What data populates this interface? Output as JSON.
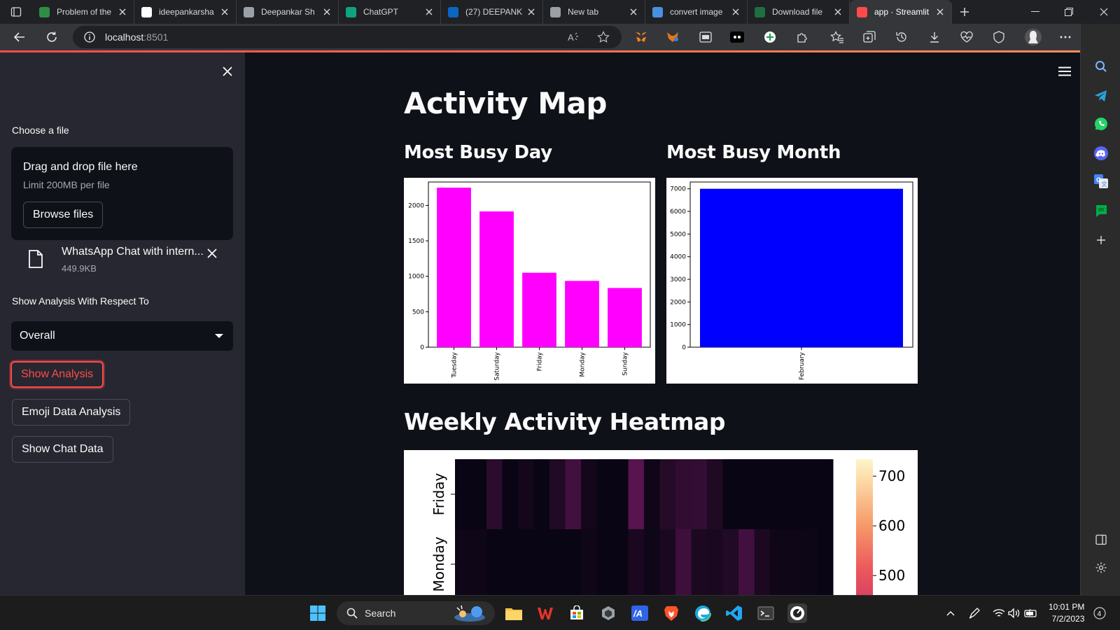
{
  "browser": {
    "tabs": [
      {
        "label": "Problem of the",
        "icon": "gfg-icon",
        "color": "#2f8d46"
      },
      {
        "label": "ideepankarsha",
        "icon": "github-icon",
        "color": "#ffffff"
      },
      {
        "label": "Deepankar Sh",
        "icon": "document-icon",
        "color": "#9aa0a6"
      },
      {
        "label": "ChatGPT",
        "icon": "chatgpt-icon",
        "color": "#10a37f"
      },
      {
        "label": "(27) DEEPANK",
        "icon": "linkedin-icon",
        "color": "#0a66c2"
      },
      {
        "label": "New tab",
        "icon": "newtab-icon",
        "color": "#9aa0a6"
      },
      {
        "label": "convert image",
        "icon": "search-icon",
        "color": "#4a90e2"
      },
      {
        "label": "Download file",
        "icon": "excel-icon",
        "color": "#1d6f42"
      },
      {
        "label": "app · Streamlit",
        "icon": "streamlit-icon",
        "color": "#ff4b4b",
        "active": true
      }
    ],
    "url_host": "localhost",
    "url_port": ":8501"
  },
  "sidebar": {
    "choose_file_label": "Choose a file",
    "dropzone_title": "Drag and drop file here",
    "dropzone_limit": "Limit 200MB per file",
    "browse_label": "Browse files",
    "uploaded_file": {
      "name": "WhatsApp Chat with intern...",
      "size": "449.9KB"
    },
    "analysis_label": "Show Analysis With Respect To",
    "analysis_selected": "Overall",
    "buttons": {
      "show_analysis": "Show Analysis",
      "emoji_analysis": "Emoji Data Analysis",
      "show_chat": "Show Chat Data"
    }
  },
  "main": {
    "title": "Activity Map",
    "busy_day_title": "Most Busy Day",
    "busy_month_title": "Most Busy Month",
    "heatmap_title": "Weekly Activity Heatmap"
  },
  "chart_data": [
    {
      "type": "bar",
      "categories": [
        "Tuesday",
        "Saturday",
        "Friday",
        "Monday",
        "Sunday"
      ],
      "values": [
        2250,
        1915,
        1050,
        935,
        835
      ],
      "ylim": [
        0,
        2330
      ],
      "yticks": [
        0,
        500,
        1000,
        1500,
        2000
      ],
      "color": "#ff00ff"
    },
    {
      "type": "bar",
      "categories": [
        "February"
      ],
      "values": [
        7000
      ],
      "ylim": [
        0,
        7300
      ],
      "yticks": [
        0,
        1000,
        2000,
        3000,
        4000,
        5000,
        6000,
        7000
      ],
      "color": "#0000ff"
    },
    {
      "type": "heatmap",
      "rows": [
        "Friday",
        "Monday"
      ],
      "cbar_ticks": [
        700,
        600,
        500
      ],
      "rows_values": [
        [
          0,
          0,
          130,
          0,
          40,
          0,
          90,
          220,
          40,
          0,
          0,
          300,
          20,
          110,
          150,
          160,
          80,
          0,
          0,
          0,
          0,
          0,
          0,
          0
        ],
        [
          20,
          20,
          0,
          0,
          0,
          0,
          0,
          0,
          20,
          0,
          0,
          60,
          20,
          60,
          200,
          70,
          60,
          90,
          220,
          70,
          20,
          20,
          10,
          0
        ]
      ]
    }
  ],
  "taskbar": {
    "search_label": "Search",
    "time": "10:01 PM",
    "date": "7/2/2023",
    "notification_count": "4"
  }
}
